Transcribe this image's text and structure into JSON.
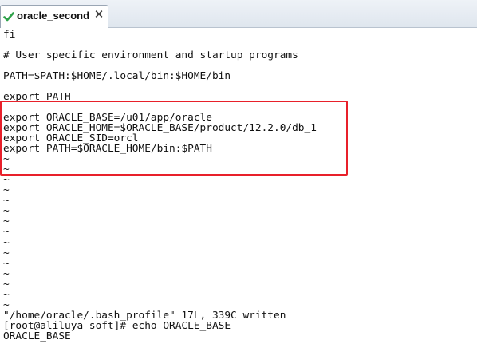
{
  "tab": {
    "title": "oracle_second",
    "close_glyph": "✕",
    "status_icon": "green-check-icon"
  },
  "terminal": {
    "lines": [
      "fi",
      "",
      "# User specific environment and startup programs",
      "",
      "PATH=$PATH:$HOME/.local/bin:$HOME/bin",
      "",
      "export PATH",
      "",
      "export ORACLE_BASE=/u01/app/oracle",
      "export ORACLE_HOME=$ORACLE_BASE/product/12.2.0/db_1",
      "export ORACLE_SID=orcl",
      "export PATH=$ORACLE_HOME/bin:$PATH",
      "~",
      "~",
      "~",
      "~",
      "~",
      "~",
      "~",
      "~",
      "~",
      "~",
      "~",
      "~",
      "~",
      "~",
      "~",
      "\"/home/oracle/.bash_profile\" 17L, 339C written",
      "[root@aliluya soft]# echo ORACLE_BASE",
      "ORACLE_BASE"
    ]
  },
  "colors": {
    "highlight_border": "#e8202a",
    "check_green": "#2fa24a"
  }
}
